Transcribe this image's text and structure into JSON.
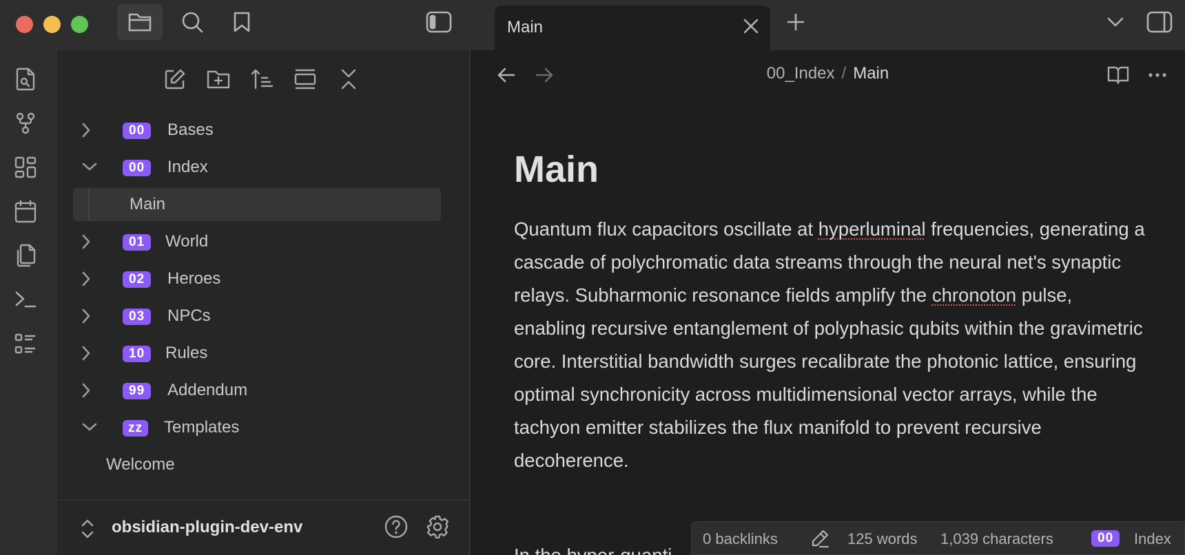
{
  "tabs": [
    {
      "title": "Main"
    }
  ],
  "sidebar": {
    "tree": [
      {
        "badge": "00",
        "label": "Bases",
        "expanded": false
      },
      {
        "badge": "00",
        "label": "Index",
        "expanded": true
      },
      {
        "label": "Main",
        "selected": true
      },
      {
        "badge": "01",
        "label": "World",
        "expanded": false
      },
      {
        "badge": "02",
        "label": "Heroes",
        "expanded": false
      },
      {
        "badge": "03",
        "label": "NPCs",
        "expanded": false
      },
      {
        "badge": "10",
        "label": "Rules",
        "expanded": false
      },
      {
        "badge": "99",
        "label": "Addendum",
        "expanded": false
      },
      {
        "badge": "zz",
        "label": "Templates",
        "expanded": true
      },
      {
        "label": "Welcome"
      }
    ],
    "vault_name": "obsidian-plugin-dev-env"
  },
  "breadcrumb": {
    "parent": "00_Index",
    "separator": "/",
    "current": "Main"
  },
  "document": {
    "title": "Main",
    "body": {
      "p1": "Quantum flux capacitors oscillate at ",
      "w1": "hyperluminal",
      "p2": " frequencies, generating a cascade of polychromatic data streams through the neural net's synaptic relays. Subharmonic resonance fields amplify the ",
      "w2": "chronoton",
      "p3": " pulse, enabling recursive entanglement of polyphasic qubits within the gravimetric core. Interstitial bandwidth surges recalibrate the photonic lattice, ensuring optimal synchronicity across multidimensional vector arrays, while the tachyon emitter stabilizes the flux manifold to prevent recursive decoherence."
    },
    "next_fragment": "In the hyper-quanti"
  },
  "status": {
    "backlinks": "0 backlinks",
    "words": "125 words",
    "characters": "1,039 characters",
    "tag_badge": "00",
    "tag_label": "Index"
  },
  "colors": {
    "accent": "#8a5cf5",
    "background": "#1e1e1e",
    "sidebar": "#262626",
    "chrome": "#2e2e2e"
  }
}
